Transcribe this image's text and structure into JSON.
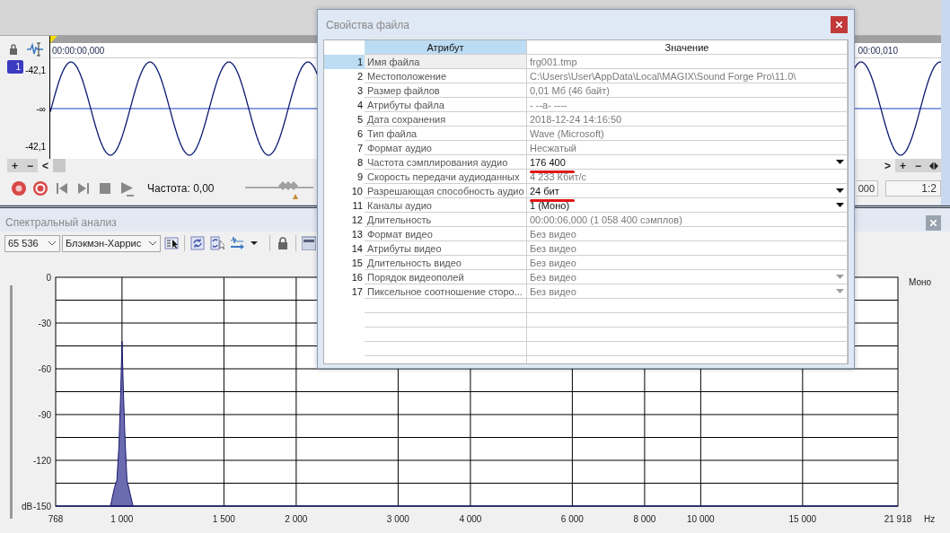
{
  "wave_window": {
    "ruler_times": [
      "00:00:00,000",
      "00:00,010"
    ],
    "channel": "1",
    "scale": [
      "-42,1",
      "-∞",
      "-42,1"
    ],
    "zoom_left": [
      "+",
      "−",
      "<"
    ],
    "zoom_right": [
      ">",
      "+",
      "−"
    ],
    "frequency": "Частота: 0,00",
    "slider": {
      "level": 0.65
    },
    "fields": [
      "000",
      "1:2"
    ]
  },
  "spectrum": {
    "title": "Спектральный анализ",
    "fft_size": "65 536",
    "window_function": "Блэкмэн-Харрис",
    "channel": "Моно",
    "y_unit": "dB",
    "x_unit": "Hz",
    "y_labels": [
      "0",
      "-30",
      "-60",
      "-90",
      "-120",
      "-150"
    ],
    "x_labels": [
      "768",
      "1 000",
      "1 500",
      "2 000",
      "3 000",
      "4 000",
      "6 000",
      "8 000",
      "10 000",
      "15 000",
      "21 918"
    ]
  },
  "dialog": {
    "title": "Свойства файла",
    "columns": [
      {
        "label": "Атрибут",
        "selected": true
      },
      {
        "label": "Значение",
        "selected": false
      }
    ],
    "rows": [
      {
        "number": "1",
        "attribute": "Имя файла",
        "value": "frg001.tmp",
        "selected": true,
        "editable": false,
        "dropdown": false,
        "underlined": false
      },
      {
        "number": "2",
        "attribute": "Местоположение",
        "value": "C:\\Users\\User\\AppData\\Local\\MAGIX\\Sound Forge Pro\\11.0\\",
        "selected": false,
        "editable": false,
        "dropdown": false,
        "underlined": false
      },
      {
        "number": "3",
        "attribute": "Размер файлов",
        "value": "0,01 Мб (46 байт)",
        "selected": false,
        "editable": false,
        "dropdown": false,
        "underlined": false
      },
      {
        "number": "4",
        "attribute": "Атрибуты файла",
        "value": "- --a- ----",
        "selected": false,
        "editable": false,
        "dropdown": false,
        "underlined": false
      },
      {
        "number": "5",
        "attribute": "Дата сохранения",
        "value": "2018-12-24  14:16:50",
        "selected": false,
        "editable": false,
        "dropdown": false,
        "underlined": false
      },
      {
        "number": "6",
        "attribute": "Тип файла",
        "value": "Wave (Microsoft)",
        "selected": false,
        "editable": false,
        "dropdown": false,
        "underlined": false
      },
      {
        "number": "7",
        "attribute": "Формат аудио",
        "value": "Несжатый",
        "selected": false,
        "editable": false,
        "dropdown": false,
        "underlined": false
      },
      {
        "number": "8",
        "attribute": "Частота сэмплирования аудио",
        "value": "176 400",
        "selected": false,
        "editable": true,
        "dropdown": true,
        "underlined": true
      },
      {
        "number": "9",
        "attribute": "Скорость передачи аудиоданных",
        "value": "4 233 Кбит/с",
        "selected": false,
        "editable": false,
        "dropdown": false,
        "underlined": false
      },
      {
        "number": "10",
        "attribute": "Разрешающая способность аудио",
        "value": "24 бит",
        "selected": false,
        "editable": true,
        "dropdown": true,
        "underlined": true
      },
      {
        "number": "11",
        "attribute": "Каналы аудио",
        "value": "1  (Моно)",
        "selected": false,
        "editable": true,
        "dropdown": true,
        "underlined": false
      },
      {
        "number": "12",
        "attribute": "Длительность",
        "value": "00:00:06,000 (1 058 400 сэмплов)",
        "selected": false,
        "editable": false,
        "dropdown": false,
        "underlined": false
      },
      {
        "number": "13",
        "attribute": "Формат видео",
        "value": "Без видео",
        "selected": false,
        "editable": false,
        "dropdown": false,
        "underlined": false
      },
      {
        "number": "14",
        "attribute": "Атрибуты видео",
        "value": "Без видео",
        "selected": false,
        "editable": false,
        "dropdown": false,
        "underlined": false
      },
      {
        "number": "15",
        "attribute": "Длительность видео",
        "value": "Без видео",
        "selected": false,
        "editable": false,
        "dropdown": false,
        "underlined": false
      },
      {
        "number": "16",
        "attribute": "Порядок видеополей",
        "value": "Без видео",
        "selected": false,
        "editable": false,
        "dropdown": true,
        "underlined": false
      },
      {
        "number": "17",
        "attribute": "Пиксельное соотношение сторо...",
        "value": "Без видео",
        "selected": false,
        "editable": false,
        "dropdown": true,
        "underlined": false
      }
    ]
  }
}
